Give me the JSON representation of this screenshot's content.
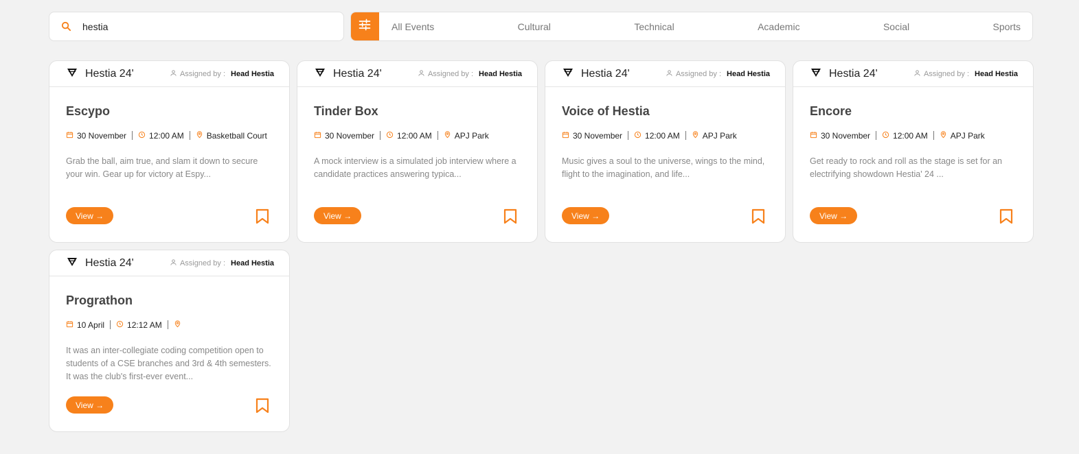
{
  "search": {
    "value": "hestia",
    "icon": "search-icon"
  },
  "filter_button": {
    "icon": "sliders-icon"
  },
  "tabs": [
    {
      "label": "All Events"
    },
    {
      "label": "Cultural"
    },
    {
      "label": "Technical"
    },
    {
      "label": "Academic"
    },
    {
      "label": "Social"
    },
    {
      "label": "Sports"
    }
  ],
  "colors": {
    "accent": "#f7811b",
    "background": "#f2f2f2"
  },
  "cards": [
    {
      "brand": "Hestia 24'",
      "assigned_label": "Assigned by :",
      "assigned_by": "Head Hestia",
      "title": "Escypo",
      "date": "30 November",
      "time": "12:00 AM",
      "location": "Basketball Court",
      "description": "Grab the ball, aim true, and slam it down to secure your win. Gear up for victory at Espy...",
      "view_label": "View →"
    },
    {
      "brand": "Hestia 24'",
      "assigned_label": "Assigned by :",
      "assigned_by": "Head Hestia",
      "title": "Tinder Box",
      "date": "30 November",
      "time": "12:00 AM",
      "location": "APJ Park",
      "description": "A mock interview is a simulated job interview where a candidate practices answering typica...",
      "view_label": "View →"
    },
    {
      "brand": "Hestia 24'",
      "assigned_label": "Assigned by :",
      "assigned_by": "Head Hestia",
      "title": "Voice of Hestia",
      "date": "30 November",
      "time": "12:00 AM",
      "location": "APJ Park",
      "description": "Music gives a soul to the universe, wings to the mind, flight to the imagination, and life...",
      "view_label": "View →"
    },
    {
      "brand": "Hestia 24'",
      "assigned_label": "Assigned by :",
      "assigned_by": "Head Hestia",
      "title": "Encore",
      "date": "30 November",
      "time": "12:00 AM",
      "location": "APJ Park",
      "description": "Get ready to rock and roll as the stage is set for an electrifying showdown Hestia' 24 ...",
      "view_label": "View →"
    },
    {
      "brand": "Hestia 24'",
      "assigned_label": "Assigned by :",
      "assigned_by": "Head Hestia",
      "title": "Prograthon",
      "date": "10 April",
      "time": "12:12 AM",
      "location": "",
      "description": "It was an inter-collegiate coding competition open to students of a CSE branches and 3rd & 4th semesters. It was the club's first-ever event...",
      "view_label": "View →"
    }
  ]
}
